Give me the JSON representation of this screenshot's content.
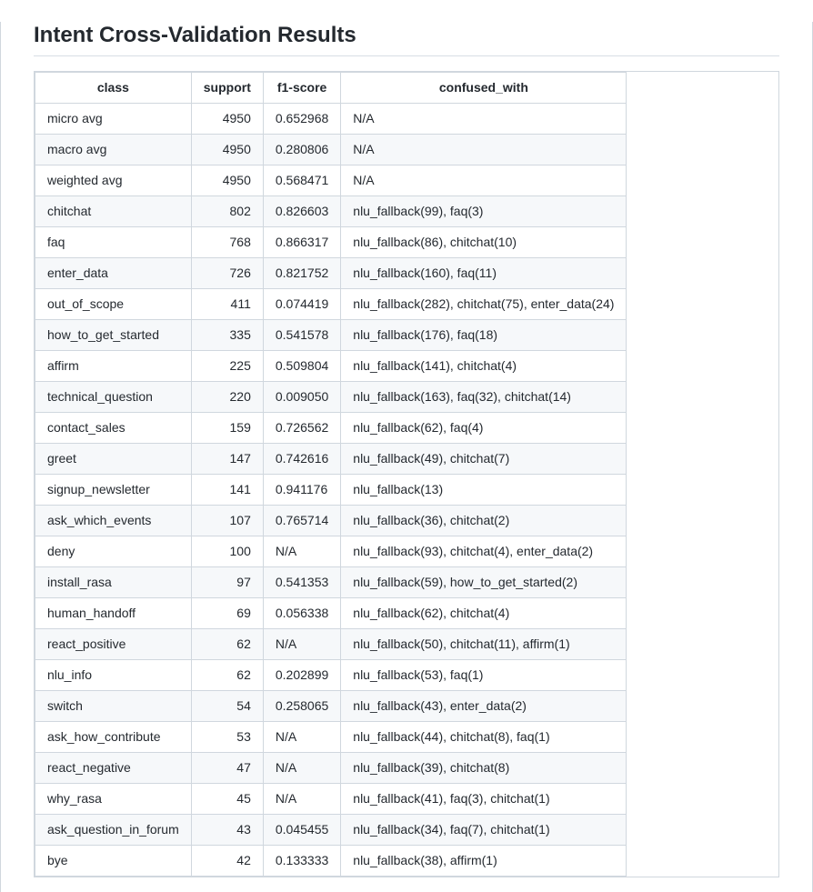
{
  "title": "Intent Cross-Validation Results",
  "headers": {
    "class": "class",
    "support": "support",
    "f1": "f1-score",
    "confused": "confused_with"
  },
  "rows": [
    {
      "class": "micro avg",
      "support": "4950",
      "f1": "0.652968",
      "confused": "N/A"
    },
    {
      "class": "macro avg",
      "support": "4950",
      "f1": "0.280806",
      "confused": "N/A"
    },
    {
      "class": "weighted avg",
      "support": "4950",
      "f1": "0.568471",
      "confused": "N/A"
    },
    {
      "class": "chitchat",
      "support": "802",
      "f1": "0.826603",
      "confused": "nlu_fallback(99), faq(3)"
    },
    {
      "class": "faq",
      "support": "768",
      "f1": "0.866317",
      "confused": "nlu_fallback(86), chitchat(10)"
    },
    {
      "class": "enter_data",
      "support": "726",
      "f1": "0.821752",
      "confused": "nlu_fallback(160), faq(11)"
    },
    {
      "class": "out_of_scope",
      "support": "411",
      "f1": "0.074419",
      "confused": "nlu_fallback(282), chitchat(75), enter_data(24)"
    },
    {
      "class": "how_to_get_started",
      "support": "335",
      "f1": "0.541578",
      "confused": "nlu_fallback(176), faq(18)"
    },
    {
      "class": "affirm",
      "support": "225",
      "f1": "0.509804",
      "confused": "nlu_fallback(141), chitchat(4)"
    },
    {
      "class": "technical_question",
      "support": "220",
      "f1": "0.009050",
      "confused": "nlu_fallback(163), faq(32), chitchat(14)"
    },
    {
      "class": "contact_sales",
      "support": "159",
      "f1": "0.726562",
      "confused": "nlu_fallback(62), faq(4)"
    },
    {
      "class": "greet",
      "support": "147",
      "f1": "0.742616",
      "confused": "nlu_fallback(49), chitchat(7)"
    },
    {
      "class": "signup_newsletter",
      "support": "141",
      "f1": "0.941176",
      "confused": "nlu_fallback(13)"
    },
    {
      "class": "ask_which_events",
      "support": "107",
      "f1": "0.765714",
      "confused": "nlu_fallback(36), chitchat(2)"
    },
    {
      "class": "deny",
      "support": "100",
      "f1": "N/A",
      "confused": "nlu_fallback(93), chitchat(4), enter_data(2)"
    },
    {
      "class": "install_rasa",
      "support": "97",
      "f1": "0.541353",
      "confused": "nlu_fallback(59), how_to_get_started(2)"
    },
    {
      "class": "human_handoff",
      "support": "69",
      "f1": "0.056338",
      "confused": "nlu_fallback(62), chitchat(4)"
    },
    {
      "class": "react_positive",
      "support": "62",
      "f1": "N/A",
      "confused": "nlu_fallback(50), chitchat(11), affirm(1)"
    },
    {
      "class": "nlu_info",
      "support": "62",
      "f1": "0.202899",
      "confused": "nlu_fallback(53), faq(1)"
    },
    {
      "class": "switch",
      "support": "54",
      "f1": "0.258065",
      "confused": "nlu_fallback(43), enter_data(2)"
    },
    {
      "class": "ask_how_contribute",
      "support": "53",
      "f1": "N/A",
      "confused": "nlu_fallback(44), chitchat(8), faq(1)"
    },
    {
      "class": "react_negative",
      "support": "47",
      "f1": "N/A",
      "confused": "nlu_fallback(39), chitchat(8)"
    },
    {
      "class": "why_rasa",
      "support": "45",
      "f1": "N/A",
      "confused": "nlu_fallback(41), faq(3), chitchat(1)"
    },
    {
      "class": "ask_question_in_forum",
      "support": "43",
      "f1": "0.045455",
      "confused": "nlu_fallback(34), faq(7), chitchat(1)"
    },
    {
      "class": "bye",
      "support": "42",
      "f1": "0.133333",
      "confused": "nlu_fallback(38), affirm(1)"
    }
  ]
}
